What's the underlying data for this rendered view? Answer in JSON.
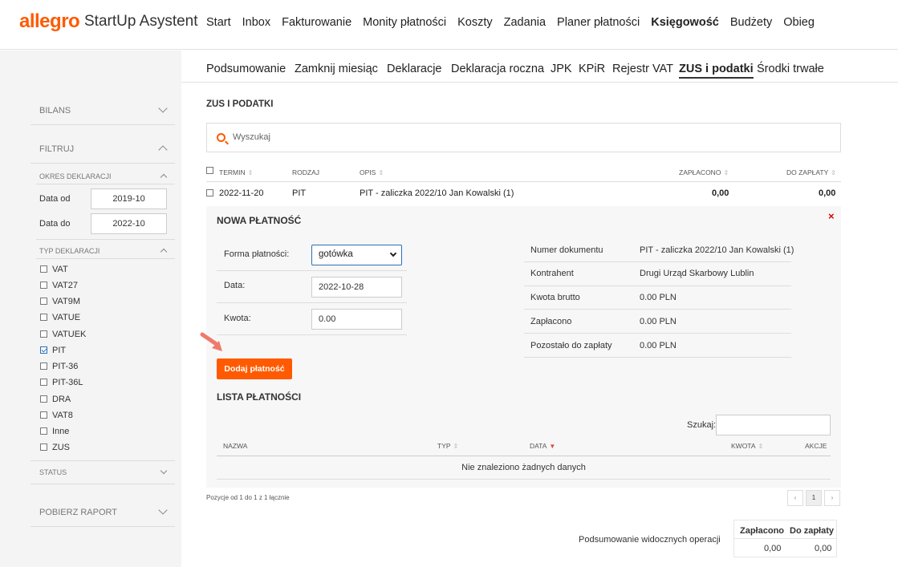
{
  "header": {
    "logo": "allegro",
    "app_title": "StartUp Asystent",
    "nav": [
      "Start",
      "Inbox",
      "Fakturowanie",
      "Monity płatności",
      "Koszty",
      "Zadania",
      "Planer płatności",
      "Księgowość",
      "Budżety",
      "Obieg"
    ],
    "active_nav": "Księgowość"
  },
  "subnav": {
    "items": [
      "Podsumowanie",
      "Zamknij miesiąc",
      "Deklaracje",
      "Deklaracja roczna",
      "JPK",
      "KPiR",
      "Rejestr VAT",
      "ZUS i podatki",
      "Środki trwałe"
    ],
    "active": "ZUS i podatki"
  },
  "sidebar": {
    "bilans": "BILANS",
    "filtruj": "FILTRUJ",
    "okres": "OKRES DEKLARACJI",
    "data_od_label": "Data od",
    "data_od_value": "2019-10",
    "data_do_label": "Data do",
    "data_do_value": "2022-10",
    "typ": "TYP DEKLARACJI",
    "types": [
      {
        "label": "VAT",
        "checked": false
      },
      {
        "label": "VAT27",
        "checked": false
      },
      {
        "label": "VAT9M",
        "checked": false
      },
      {
        "label": "VATUE",
        "checked": false
      },
      {
        "label": "VATUEK",
        "checked": false
      },
      {
        "label": "PIT",
        "checked": true
      },
      {
        "label": "PIT-36",
        "checked": false
      },
      {
        "label": "PIT-36L",
        "checked": false
      },
      {
        "label": "DRA",
        "checked": false
      },
      {
        "label": "VAT8",
        "checked": false
      },
      {
        "label": "Inne",
        "checked": false
      },
      {
        "label": "ZUS",
        "checked": false
      }
    ],
    "status": "STATUS",
    "pobierz": "POBIERZ RAPORT"
  },
  "main": {
    "title": "ZUS I PODATKI",
    "search_placeholder": "Wyszukaj",
    "columns": {
      "termin": "TERMIN",
      "rodzaj": "RODZAJ",
      "opis": "OPIS",
      "zaplacono": "ZAPŁACONO",
      "do_zaplaty": "DO ZAPŁATY"
    },
    "row": {
      "termin": "2022-11-20",
      "rodzaj": "PIT",
      "opis": "PIT - zaliczka 2022/10 Jan Kowalski (1)",
      "zaplacono": "0,00",
      "do_zaplaty": "0,00"
    }
  },
  "payment": {
    "title": "NOWA PŁATNOŚĆ",
    "close": "×",
    "forma_label": "Forma płatności:",
    "forma_value": "gotówka",
    "data_label": "Data:",
    "data_value": "2022-10-28",
    "kwota_label": "Kwota:",
    "kwota_value": "0.00",
    "button": "Dodaj płatność",
    "info": [
      {
        "label": "Numer dokumentu",
        "value": "PIT - zaliczka 2022/10 Jan Kowalski (1)"
      },
      {
        "label": "Kontrahent",
        "value": "Drugi Urząd Skarbowy Lublin"
      },
      {
        "label": "Kwota brutto",
        "value": "0.00 PLN"
      },
      {
        "label": "Zapłacono",
        "value": "0.00 PLN"
      },
      {
        "label": "Pozostało do zapłaty",
        "value": "0.00 PLN"
      }
    ]
  },
  "payments_list": {
    "title": "LISTA PŁATNOŚCI",
    "search_label": "Szukaj:",
    "columns": {
      "nazwa": "NAZWA",
      "typ": "TYP",
      "data": "DATA",
      "kwota": "KWOTA",
      "akcje": "AKCJE"
    },
    "empty": "Nie znaleziono żadnych danych"
  },
  "pagination": {
    "info": "Pozycje od 1 do 1 z 1 łącznie",
    "prev": "‹",
    "page": "1",
    "next": "›"
  },
  "summary": {
    "label": "Podsumowanie widocznych operacji",
    "zaplacono_label": "Zapłacono",
    "do_zaplaty_label": "Do zapłaty",
    "zaplacono": "0,00",
    "do_zaplaty": "0,00"
  }
}
